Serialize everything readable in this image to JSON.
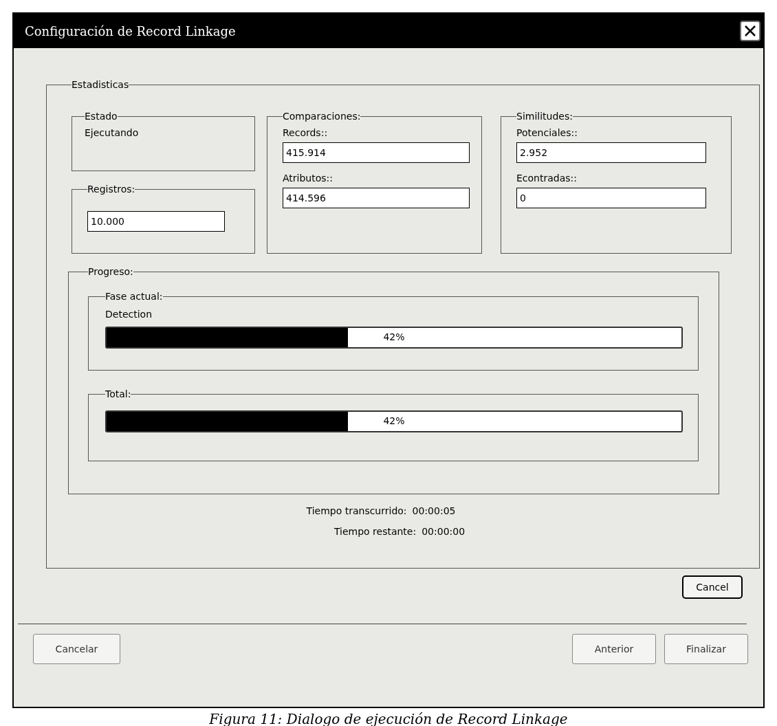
{
  "window": {
    "title": "Configuración de Record Linkage"
  },
  "statistics": {
    "title": "Estadisticas",
    "estado": {
      "title": "Estado",
      "value": "Ejecutando"
    },
    "registros": {
      "title": "Registros:",
      "value": "10.000"
    },
    "comparaciones": {
      "title": "Comparaciones:",
      "fields": [
        {
          "label": "Records::",
          "value": "415.914"
        },
        {
          "label": "Atributos::",
          "value": "414.596"
        }
      ]
    },
    "similitudes": {
      "title": "Similitudes:",
      "fields": [
        {
          "label": "Potenciales::",
          "value": "2.952"
        },
        {
          "label": "Econtradas::",
          "value": "0"
        }
      ]
    },
    "progress": {
      "title": "Progreso:",
      "phase": {
        "title": "Fase actual:",
        "name": "Detection",
        "level": 0.42,
        "reading": "42%"
      },
      "total": {
        "title": "Total:",
        "level": 0.42,
        "reading": "42%"
      }
    },
    "times": [
      {
        "label": "Tiempo transcurrido:",
        "value": "00:00:05"
      },
      {
        "label": "Tiempo restante:",
        "value": "00:00:00"
      }
    ]
  },
  "cancel_button": "Cancel",
  "footer_buttons": [
    {
      "label": "Cancelar"
    },
    {
      "label": "Anterior"
    },
    {
      "label": "Finalizar"
    }
  ],
  "caption": "Figura 11: Dialogo de ejecución de Record Linkage"
}
